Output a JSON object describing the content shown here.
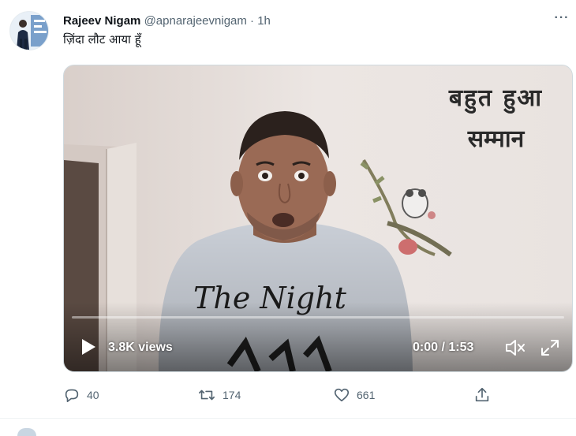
{
  "tweet": {
    "author_name": "Rajeev Nigam",
    "handle": "@apnarajeevnigam",
    "separator": "·",
    "time": "1h",
    "more_label": "···",
    "text": "ज़िंदा लौट आया हूँ"
  },
  "media": {
    "caption_line1": "बहुत हुआ",
    "caption_line2": "सम्मान",
    "shirt_text": "The Night",
    "views": "3.8K views",
    "time_readout": "0:00 / 1:53",
    "progress": 0,
    "accent_color": "#1d9bf0"
  },
  "actions": {
    "reply_count": "40",
    "retweet_count": "174",
    "like_count": "661"
  },
  "icons": {
    "reply": "reply-icon",
    "retweet": "retweet-icon",
    "like": "like-icon",
    "share": "share-icon",
    "play": "play-icon",
    "mute": "mute-icon",
    "fullscreen": "fullscreen-icon"
  }
}
